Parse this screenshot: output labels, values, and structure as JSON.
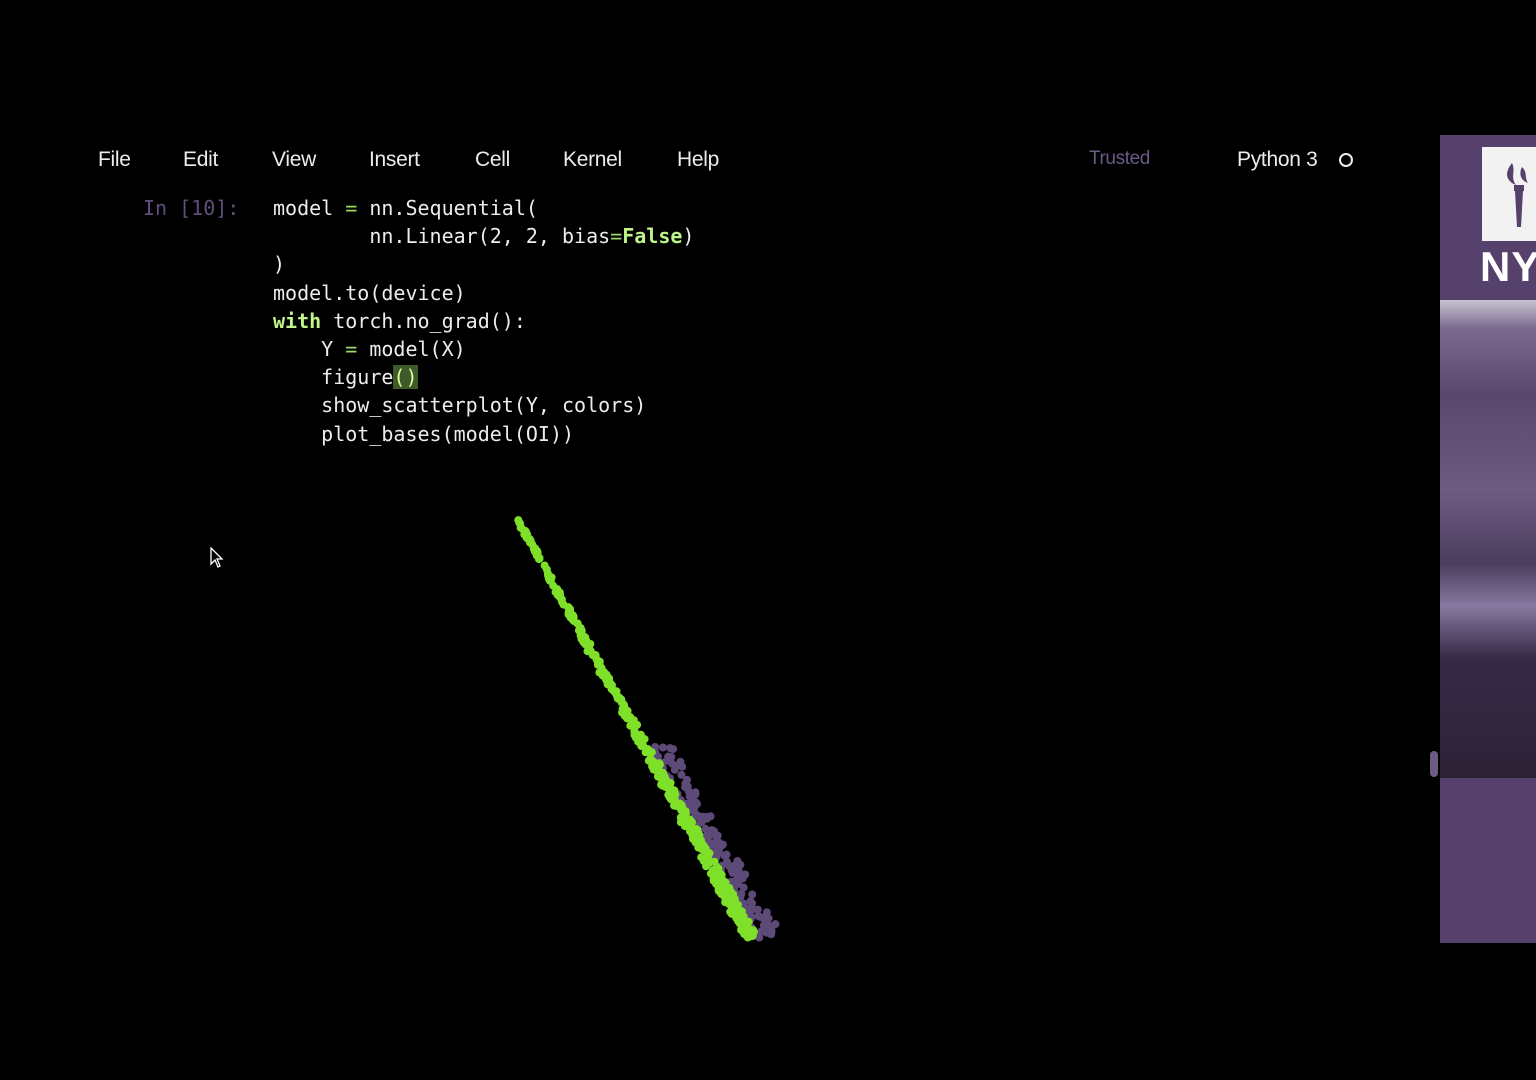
{
  "menu": {
    "items": [
      "File",
      "Edit",
      "View",
      "Insert",
      "Cell",
      "Kernel",
      "Help"
    ],
    "trusted_label": "Trusted",
    "kernel_name": "Python 3"
  },
  "cell": {
    "prompt": "In [10]:",
    "code_lines": [
      "model = nn.Sequential(",
      "        nn.Linear(2, 2, bias=False)",
      ")",
      "model.to(device)",
      "with torch.no_grad():",
      "    Y = model(X)",
      "    figure()",
      "    show_scatterplot(Y, colors)",
      "    plot_bases(model(OI))"
    ]
  },
  "output_plot": {
    "description_type": "scatter",
    "point_color_primary": "#7fe02a",
    "point_color_secondary": "#5d4a78"
  },
  "sidebar": {
    "logo_text": "NY",
    "accent_color": "#56406c"
  }
}
